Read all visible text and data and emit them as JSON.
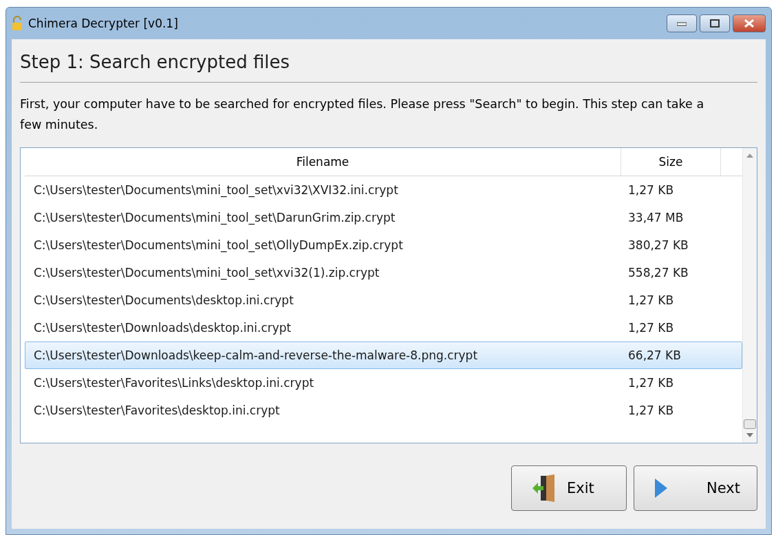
{
  "window": {
    "title": "Chimera Decrypter [v0.1]"
  },
  "heading": "Step 1: Search encrypted files",
  "description": "First, your computer have to be searched for encrypted files. Please press \"Search\" to begin. This step can take a few minutes.",
  "table": {
    "columns": [
      "Filename",
      "Size"
    ],
    "rows": [
      {
        "filename": "C:\\Users\\tester\\Documents\\mini_tool_set\\xvi32\\XVI32.ini.crypt",
        "size": "1,27 KB",
        "selected": false
      },
      {
        "filename": "C:\\Users\\tester\\Documents\\mini_tool_set\\DarunGrim.zip.crypt",
        "size": "33,47 MB",
        "selected": false
      },
      {
        "filename": "C:\\Users\\tester\\Documents\\mini_tool_set\\OllyDumpEx.zip.crypt",
        "size": "380,27 KB",
        "selected": false
      },
      {
        "filename": "C:\\Users\\tester\\Documents\\mini_tool_set\\xvi32(1).zip.crypt",
        "size": "558,27 KB",
        "selected": false
      },
      {
        "filename": "C:\\Users\\tester\\Documents\\desktop.ini.crypt",
        "size": "1,27 KB",
        "selected": false
      },
      {
        "filename": "C:\\Users\\tester\\Downloads\\desktop.ini.crypt",
        "size": "1,27 KB",
        "selected": false
      },
      {
        "filename": "C:\\Users\\tester\\Downloads\\keep-calm-and-reverse-the-malware-8.png.crypt",
        "size": "66,27 KB",
        "selected": true
      },
      {
        "filename": "C:\\Users\\tester\\Favorites\\Links\\desktop.ini.crypt",
        "size": "1,27 KB",
        "selected": false
      },
      {
        "filename": "C:\\Users\\tester\\Favorites\\desktop.ini.crypt",
        "size": "1,27 KB",
        "selected": false
      }
    ]
  },
  "buttons": [
    {
      "label": "Exit",
      "kind": "exit"
    },
    {
      "label": "Next",
      "kind": "next"
    }
  ]
}
